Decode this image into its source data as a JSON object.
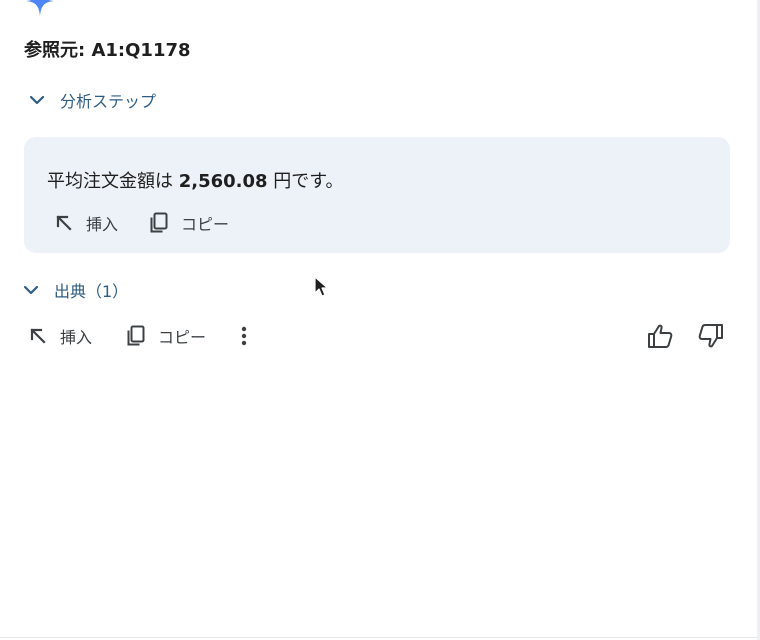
{
  "reference": {
    "title": "参照元: A1:Q1178"
  },
  "analysis_steps": {
    "label": "分析ステップ"
  },
  "answer": {
    "prefix": "平均注文金額は ",
    "value": "2,560.08",
    "suffix": " 円です。",
    "insert_label": "挿入",
    "copy_label": "コピー"
  },
  "sources": {
    "label": "出典（1）"
  },
  "footer_actions": {
    "insert_label": "挿入",
    "copy_label": "コピー"
  },
  "colors": {
    "accent": "#2f5d84",
    "card_bg": "#edf2f8",
    "sparkle": "#4f86f7"
  },
  "icons": {
    "sparkle": "gemini-sparkle-icon",
    "chevron": "chevron-down-icon",
    "insert": "arrow-up-left-icon",
    "copy": "copy-icon",
    "more": "more-vert-icon",
    "thumb_up": "thumb-up-icon",
    "thumb_down": "thumb-down-icon"
  }
}
